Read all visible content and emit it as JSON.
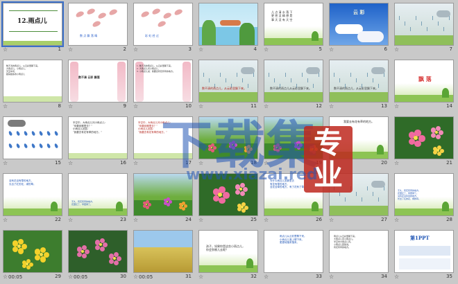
{
  "watermark": {
    "text": "下载集",
    "badge": "专业",
    "site": "www.xiazai.red"
  },
  "slides": [
    {
      "num": "1",
      "bg": "cover",
      "texts": [
        {
          "t": "12.雨点儿",
          "l": 20,
          "tp": 20,
          "s": 9,
          "c": "#222",
          "b": true
        }
      ]
    },
    {
      "num": "2",
      "bg": "drops",
      "texts": [
        {
          "t": "数 点 飘 落 晴",
          "l": 16,
          "tp": 44,
          "s": 4,
          "c": "#3366cc"
        }
      ]
    },
    {
      "num": "3",
      "bg": "drops",
      "texts": [
        {
          "t": "彩 虹 经 过",
          "l": 16,
          "tp": 44,
          "s": 4,
          "c": "#3366cc"
        }
      ]
    },
    {
      "num": "4",
      "bg": "pond",
      "texts": []
    },
    {
      "num": "5",
      "bg": "green",
      "texts": [
        {
          "t": "儿 点  清 水  落 下\n更 把  没 精  想 是\n事 天  没 有  天 空",
          "l": 10,
          "tp": 10,
          "s": 4,
          "c": "#333"
        }
      ]
    },
    {
      "num": "6",
      "bg": "sky",
      "texts": [
        {
          "t": "云 彩",
          "l": 34,
          "tp": 8,
          "s": 7,
          "c": "#f5f5dd",
          "b": true
        }
      ]
    },
    {
      "num": "7",
      "bg": "rain",
      "texts": []
    },
    {
      "num": "8",
      "bg": "text",
      "texts": [
        {
          "t": "数不清的雨点儿，从云彩里飘下来。\n大雨点儿，小雨点儿，\n天空中问，\n越来越多的小雨点儿",
          "l": 4,
          "tp": 6,
          "s": 3,
          "c": "#333"
        }
      ]
    },
    {
      "num": "9",
      "bg": "pink",
      "texts": [
        {
          "t": "数不清   云彩   飘落",
          "l": 14,
          "tp": 22,
          "s": 4,
          "c": "#333",
          "b": true
        }
      ]
    },
    {
      "num": "10",
      "bg": "pink",
      "texts": [
        {
          "t": "1. 数不清的雨点儿，从云彩里飘下来。\n2. 大雨点儿问小雨点儿，\n3. 小雨点儿说：我要去有花有草的地方。",
          "l": 4,
          "tp": 6,
          "s": 3,
          "c": "#333"
        }
      ]
    },
    {
      "num": "11",
      "bg": "rain",
      "texts": [
        {
          "t": "数不清的雨点儿，从云彩里飘下来。",
          "l": 4,
          "tp": 38,
          "s": 4,
          "c": "#b3261e"
        }
      ]
    },
    {
      "num": "12",
      "bg": "rain",
      "texts": [
        {
          "t": "数不清的雨点儿从云彩里飘下来。",
          "l": 8,
          "tp": 38,
          "s": 4,
          "c": "#3a3a3a"
        }
      ]
    },
    {
      "num": "13",
      "bg": "rain",
      "texts": [
        {
          "t": "数不清的雨点儿，从云彩里飘下来。",
          "l": 6,
          "tp": 38,
          "s": 4,
          "c": "#3a3a3a"
        }
      ]
    },
    {
      "num": "14",
      "bg": "green",
      "texts": [
        {
          "t": "飘 落",
          "l": 34,
          "tp": 22,
          "s": 8,
          "c": "#d83b3b",
          "b": true
        }
      ]
    },
    {
      "num": "15",
      "bg": "clouddrops",
      "texts": []
    },
    {
      "num": "16",
      "bg": "text",
      "texts": [
        {
          "t": "半空中，大雨点儿问小雨点儿：\n“你要到哪里去？”\n小雨点儿回答：\n“我要去有花有草的地方。”",
          "l": 6,
          "tp": 6,
          "s": 3.5,
          "c": "#333"
        }
      ]
    },
    {
      "num": "17",
      "bg": "text",
      "texts": [
        {
          "t": "半空中，大雨点儿问小雨点儿：\n“你要到哪里去？”\n小雨点儿回答：\n“我要去有花有草的地方。”",
          "l": 6,
          "tp": 6,
          "s": 3.5,
          "c": "#b3261e"
        }
      ]
    },
    {
      "num": "18",
      "bg": "garden",
      "texts": []
    },
    {
      "num": "19",
      "bg": "garden",
      "texts": []
    },
    {
      "num": "20",
      "bg": "green",
      "texts": [
        {
          "t": "我要去有花有草的地方。",
          "l": 20,
          "tp": 4,
          "s": 4,
          "c": "#333"
        }
      ]
    },
    {
      "num": "21",
      "bg": "flowers",
      "texts": []
    },
    {
      "num": "22",
      "bg": "green",
      "texts": [
        {
          "t": "没有花没有草的地方，\n长出了红的花，绿的草。",
          "l": 8,
          "tp": 8,
          "s": 3.5,
          "c": "#1f55b5"
        }
      ]
    },
    {
      "num": "23",
      "bg": "green",
      "texts": [
        {
          "t": "不久，有花有草的地方，\n花更红了，草更绿了。",
          "l": 4,
          "tp": 38,
          "s": 3,
          "c": "#1f55b5"
        }
      ]
    },
    {
      "num": "24",
      "bg": "garden",
      "texts": []
    },
    {
      "num": "25",
      "bg": "flowers",
      "texts": []
    },
    {
      "num": "26",
      "bg": "green",
      "texts": [
        {
          "t": "为什么雨点儿到那里去\n有花有草的地方，\n没花没草的地方，有了花有了草。",
          "l": 8,
          "tp": 8,
          "s": 3.5,
          "c": "#1f55b5"
        }
      ]
    },
    {
      "num": "27",
      "bg": "rain",
      "texts": []
    },
    {
      "num": "28",
      "bg": "green",
      "texts": [
        {
          "t": "不久，有花有草的地方，\n花更红了，草更绿了。\n没有花没有草的地方，\n长出了红的花，绿的草。",
          "l": 4,
          "tp": 22,
          "s": 3,
          "c": "#1f55b5"
        }
      ]
    },
    {
      "num": "29",
      "bg": "yellowflowers",
      "dur": "00:05",
      "texts": []
    },
    {
      "num": "30",
      "bg": "lotus",
      "dur": "00:05",
      "texts": []
    },
    {
      "num": "31",
      "bg": "field",
      "dur": "00:05",
      "texts": []
    },
    {
      "num": "32",
      "bg": "green",
      "texts": [
        {
          "t": "孩子，如果你是这些小雨点儿，\n你会到哪儿去呢？",
          "l": 10,
          "tp": 20,
          "s": 4,
          "c": "#333"
        }
      ]
    },
    {
      "num": "33",
      "bg": "plain",
      "texts": [
        {
          "t": "雨点儿从云彩里飘下来。\n小雨点儿落上哪下来。\n更更地落来落来。",
          "l": 22,
          "tp": 6,
          "s": 3.5,
          "c": "#1f55b5"
        }
      ]
    },
    {
      "num": "34",
      "bg": "plain",
      "texts": [
        {
          "t": "雨点儿从云彩里飘下来。\n大雨点儿问小雨点儿。\n半空中大雨点儿问。\n小雨点儿回答说。\n有花有草的地方。",
          "l": 6,
          "tp": 6,
          "s": 3,
          "c": "#333"
        }
      ]
    },
    {
      "num": "35",
      "bg": "ppt",
      "texts": [
        {
          "t": "第1PPT",
          "l": 22,
          "tp": 6,
          "s": 7,
          "c": "#1f55b5",
          "b": true
        }
      ]
    }
  ]
}
